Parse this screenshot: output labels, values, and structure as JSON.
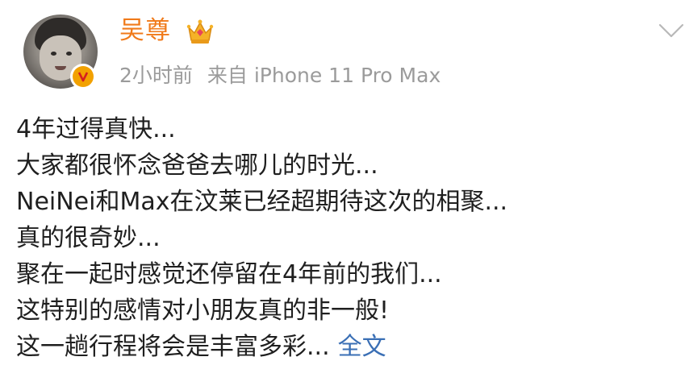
{
  "post": {
    "author": "吴尊",
    "time": "2小时前",
    "source": "来自 iPhone 11 Pro Max",
    "lines": [
      "4年过得真快...",
      "大家都很怀念爸爸去哪儿的时光...",
      "NeiNei和Max在汶莱已经超期待这次的相聚...",
      "真的很奇妙...",
      "聚在一起时感觉还停留在4年前的我们...",
      "这特别的感情对小朋友真的非一般!",
      "这一趟行程将会是丰富多彩..."
    ],
    "full_text_label": "全文"
  },
  "icons": {
    "avatar": "avatar-photo",
    "verified": "verified-badge-icon",
    "vip": "crown-icon",
    "menu": "chevron-down-icon"
  },
  "colors": {
    "author": "#f07a1a",
    "meta": "#9b9b9b",
    "link": "#3a6fb5",
    "text": "#1f1f1f",
    "verified_badge": "#f2a100"
  }
}
